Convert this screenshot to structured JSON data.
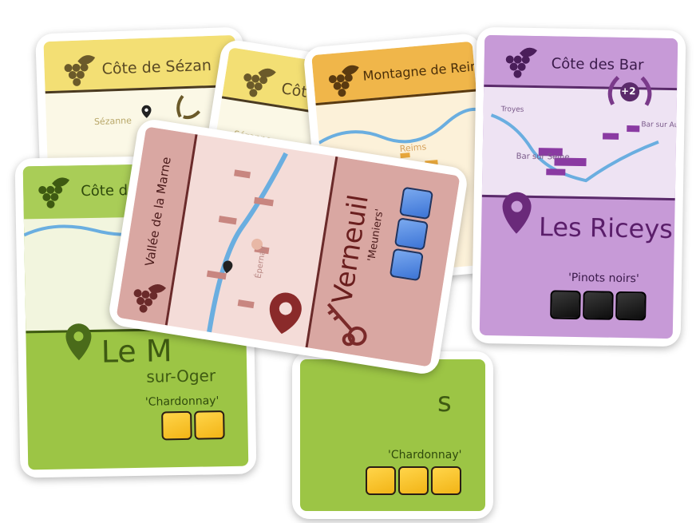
{
  "cards": {
    "sezanne": {
      "region": "Côte de Sézan",
      "place": "Sézanne"
    },
    "sezanne_back": {
      "region": "Côte",
      "place": "Sézanne"
    },
    "reims": {
      "region": "Montagne de Reims",
      "place": "Reims"
    },
    "bar": {
      "region": "Côte des Bar",
      "bonus": "+2",
      "places": [
        "Troyes",
        "Bar sur Seine",
        "Bar sur Aube"
      ],
      "village": "Les Riceys",
      "grape": "'Pinots noirs'",
      "dice_count": 3,
      "dice_color": "black"
    },
    "blancs": {
      "region": "Côte des",
      "village_partial": "Le M",
      "village_line2": "sur-Oger",
      "grape": "'Chardonnay'",
      "dice_count": 2,
      "dice_color": "yellow"
    },
    "lower_green": {
      "village_partial": "s",
      "grape": "'Chardonnay'",
      "dice_count": 3,
      "dice_color": "yellow"
    },
    "marne": {
      "region": "Vallée de la Marne",
      "place": "Épernay",
      "village": "Verneuil",
      "grape": "'Meuniers'",
      "dice_count": 3,
      "dice_color": "blue"
    }
  },
  "colors": {
    "yellow_band": "#f3df74",
    "orange_band": "#f0b64a",
    "purple_band": "#c79ad7",
    "green_band": "#9cc545",
    "rose_band": "#d9a7a2",
    "river": "#6aaee0"
  },
  "icons": [
    "grape-icon",
    "location-pin-icon",
    "laurel-icon",
    "keys-icon"
  ]
}
